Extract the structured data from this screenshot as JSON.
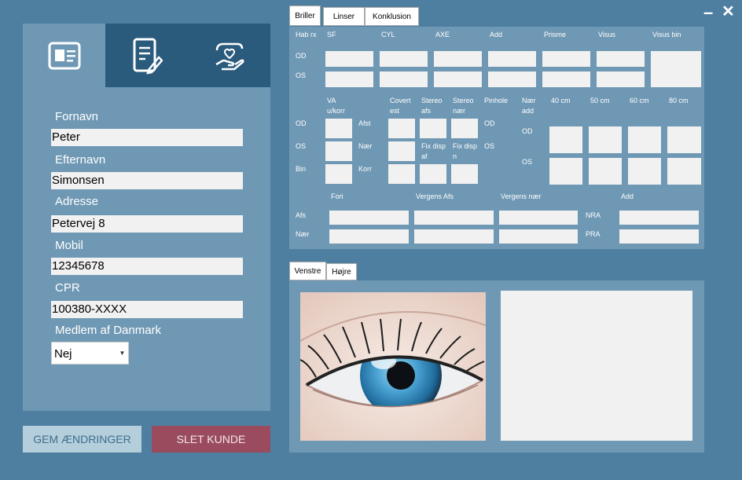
{
  "window": {
    "minimize_glyph": "–",
    "close_glyph": "✕"
  },
  "left_nav": {
    "icons": [
      "id-card-icon",
      "document-edit-icon",
      "hand-heart-icon"
    ]
  },
  "form": {
    "fornavn_label": "Fornavn",
    "fornavn_value": "Peter",
    "efternavn_label": "Efternavn",
    "efternavn_value": "Simonsen",
    "adresse_label": "Adresse",
    "adresse_value": "Petervej 8",
    "mobil_label": "Mobil",
    "mobil_value": "12345678",
    "cpr_label": "CPR",
    "cpr_value": "100380-XXXX",
    "medlem_label": "Medlem af Danmark",
    "medlem_value": "Nej"
  },
  "buttons": {
    "save": "GEM ÆNDRINGER",
    "delete": "SLET KUNDE"
  },
  "top_tabs": [
    "Briller",
    "Linser",
    "Konklusion"
  ],
  "rx": {
    "headers": [
      "Hab rx",
      "SF",
      "CYL",
      "AXE",
      "Add",
      "Prisme",
      "Visus",
      "Visus bin"
    ],
    "rows": [
      "OD",
      "OS"
    ]
  },
  "va": {
    "va_header": "VA u/korr",
    "covert_header": "Covert est",
    "stereo_afs": "Stereo afs",
    "stereo_naer": "Stereo nær",
    "rows": [
      "OD",
      "OS",
      "Bin"
    ],
    "mid_labels": [
      "Afst",
      "Nær",
      "Korr"
    ],
    "fix_disp_af": "Fix disp af",
    "fix_disp_n": "Fix disp n",
    "pinhole": "Pinhole",
    "pinhole_rows": [
      "OD",
      "OS"
    ],
    "naer_add": "Nær add",
    "naer_rows": [
      "OD",
      "OS"
    ],
    "distances": [
      "40 cm",
      "50 cm",
      "60 cm",
      "80 cm"
    ]
  },
  "fori": {
    "headers": [
      "Fori",
      "Vergens Afs",
      "Vergens nær",
      "Add"
    ],
    "rows": [
      "Afs",
      "Nær"
    ],
    "right_labels": [
      "NRA",
      "PRA"
    ]
  },
  "bottom_tabs": [
    "Venstre",
    "Højre"
  ],
  "colors": {
    "bg": "#4e7fa1",
    "panel": "#6f98b4",
    "nav_dark": "#2a5a7c",
    "save_btn": "#b4cedc",
    "delete_btn": "#9a4c5e"
  }
}
